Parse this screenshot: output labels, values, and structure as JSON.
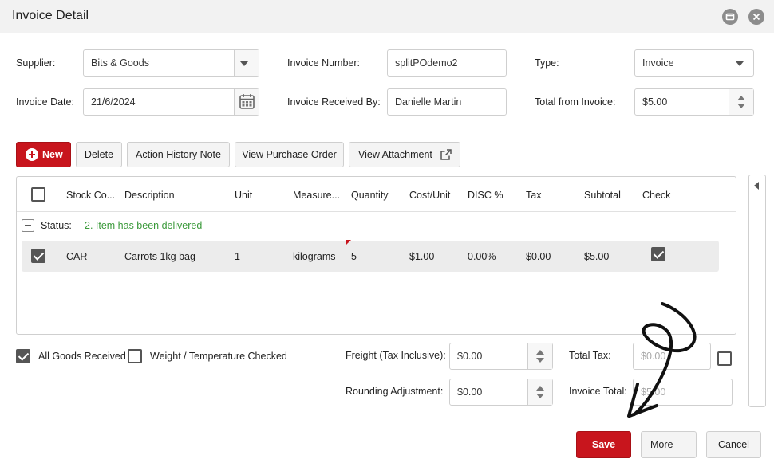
{
  "window": {
    "title": "Invoice Detail"
  },
  "form": {
    "supplier_label": "Supplier:",
    "supplier_value": "Bits & Goods",
    "invoice_number_label": "Invoice Number:",
    "invoice_number_value": "splitPOdemo2",
    "type_label": "Type:",
    "type_value": "Invoice",
    "invoice_date_label": "Invoice Date:",
    "invoice_date_value": "21/6/2024",
    "received_by_label": "Invoice Received By:",
    "received_by_value": "Danielle Martin",
    "total_from_invoice_label": "Total from Invoice:",
    "total_from_invoice_value": "$5.00"
  },
  "toolbar": {
    "new_label": "New",
    "delete_label": "Delete",
    "action_history_label": "Action History Note",
    "view_po_label": "View Purchase Order",
    "view_attachment_label": "View Attachment"
  },
  "grid": {
    "columns": [
      "Stock Co...",
      "Description",
      "Unit",
      "Measure...",
      "Quantity",
      "Cost/Unit",
      "DISC %",
      "Tax",
      "Subtotal",
      "Check"
    ],
    "group": {
      "prefix": "Status:",
      "value": "2. Item has been delivered"
    },
    "rows": [
      {
        "stock_code": "CAR",
        "description": "Carrots 1kg bag",
        "unit": "1",
        "measure": "kilograms",
        "quantity": "5",
        "cost_unit": "$1.00",
        "disc": "0.00%",
        "tax": "$0.00",
        "subtotal": "$5.00",
        "selected": true,
        "checked": true
      }
    ]
  },
  "footer": {
    "all_goods_label": "All Goods Received",
    "weight_label": "Weight / Temperature Checked",
    "freight_label": "Freight (Tax Inclusive):",
    "freight_value": "$0.00",
    "rounding_label": "Rounding Adjustment:",
    "rounding_value": "$0.00",
    "total_tax_label": "Total Tax:",
    "total_tax_value": "$0.00",
    "invoice_total_label": "Invoice Total:",
    "invoice_total_value": "$5.00"
  },
  "actions": {
    "save_label": "Save",
    "more_label": "More",
    "cancel_label": "Cancel"
  },
  "colors": {
    "accent": "#c8151d",
    "status_green": "#3b9a3b"
  }
}
